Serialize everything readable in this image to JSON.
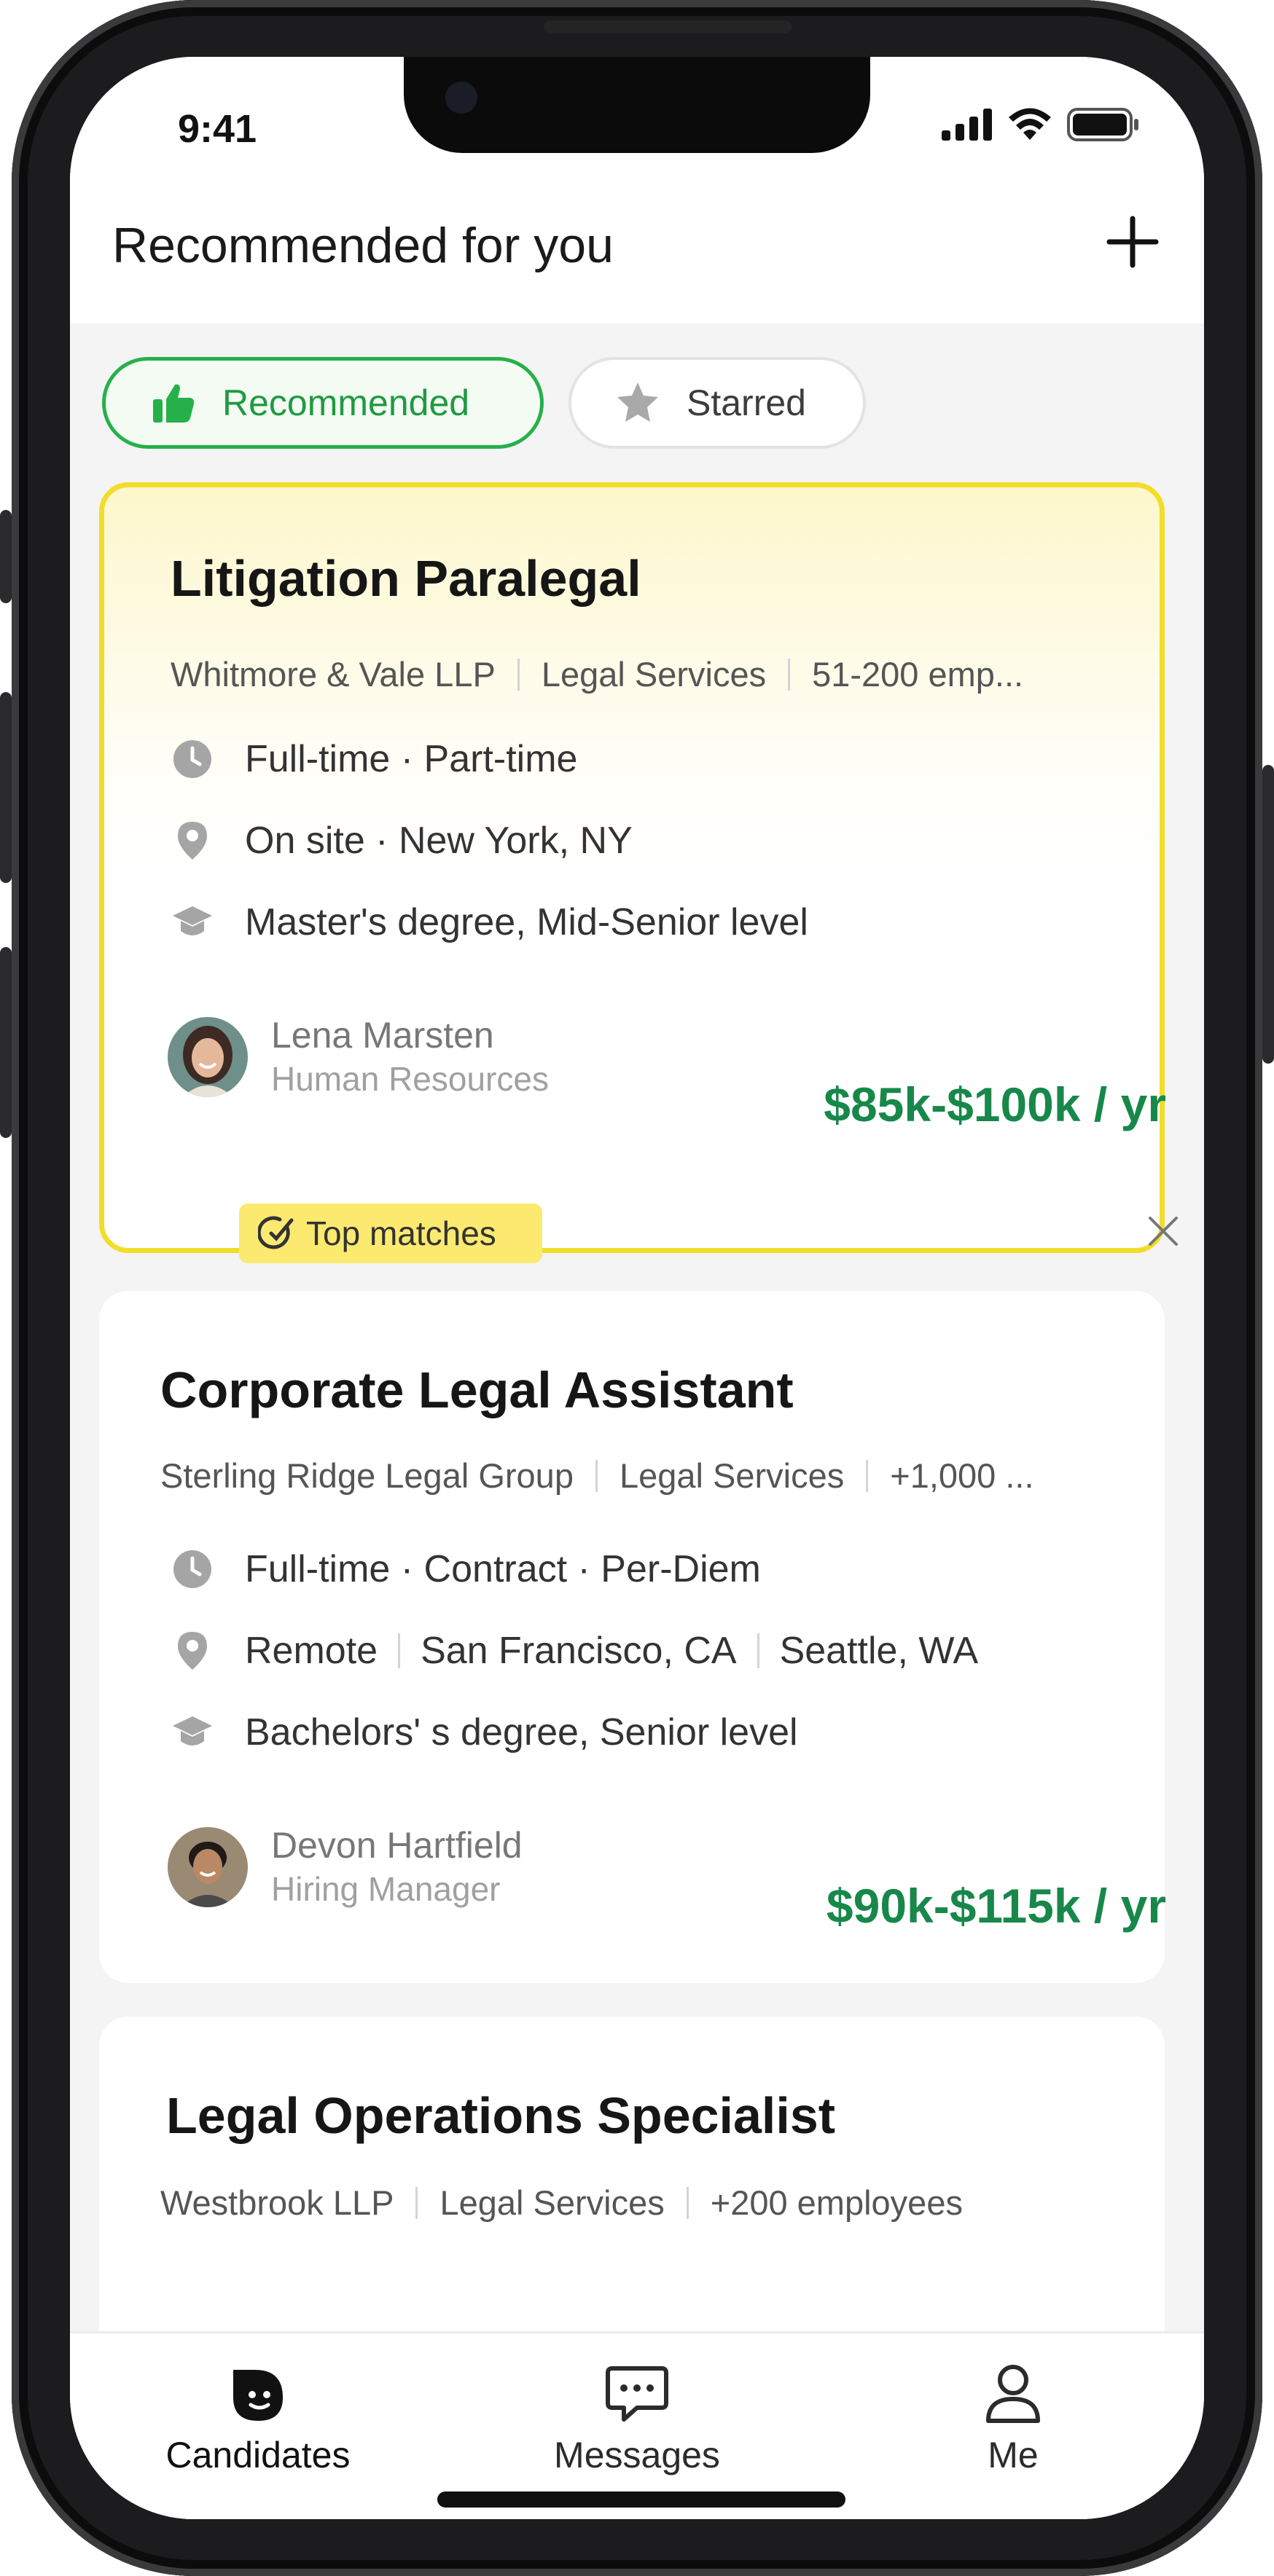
{
  "status": {
    "time": "9:41"
  },
  "header": {
    "title": "Recommended for you",
    "add_icon": "plus-icon"
  },
  "filters": [
    {
      "label": "Recommended",
      "icon": "thumbs-up-icon",
      "selected": true
    },
    {
      "label": "Starred",
      "icon": "star-icon",
      "selected": false
    }
  ],
  "jobs": [
    {
      "title": "Litigation Paralegal",
      "company": "Whitmore & Vale LLP",
      "industry": "Legal Services",
      "size": "51-200 emp...",
      "schedule": "Full-time · Part-time",
      "location": [
        "On site · New York, NY"
      ],
      "education": "Master's degree, Mid-Senior level",
      "contact": {
        "name": "Lena Marsten",
        "role": "Human Resources"
      },
      "salary": "$85k-$100k / yr",
      "badge": "Top matches",
      "highlighted": true
    },
    {
      "title": "Corporate Legal Assistant",
      "company": "Sterling Ridge Legal Group",
      "industry": "Legal Services",
      "size": "+1,000 ...",
      "schedule": "Full-time · Contract · Per-Diem",
      "location": [
        "Remote",
        "San Francisco, CA",
        "Seattle, WA"
      ],
      "education": "Bachelors' s degree, Senior level",
      "contact": {
        "name": "Devon Hartfield",
        "role": "Hiring Manager"
      },
      "salary": "$90k-$115k / yr",
      "highlighted": false
    },
    {
      "title": "Legal Operations Specialist",
      "company": "Westbrook LLP",
      "industry": "Legal Services",
      "size": "+200 employees",
      "highlighted": false
    }
  ],
  "colors": {
    "accent_green": "#17884a",
    "chip_green": "#26b04a",
    "highlight_yellow": "#f2dd2a"
  },
  "bottom_nav": [
    {
      "label": "Candidates",
      "icon": "candidates-icon",
      "active": true
    },
    {
      "label": "Messages",
      "icon": "chat-icon",
      "active": false
    },
    {
      "label": "Me",
      "icon": "person-icon",
      "active": false
    }
  ]
}
